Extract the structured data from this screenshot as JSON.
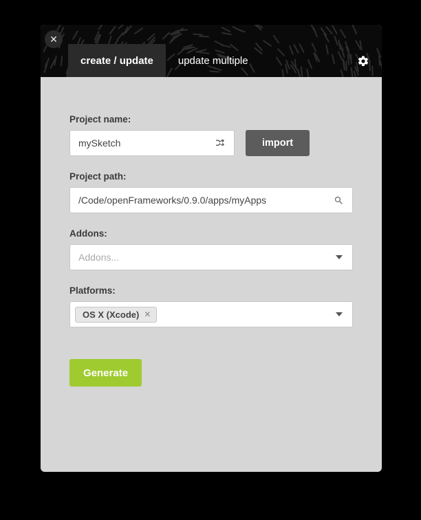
{
  "tabs": {
    "create_update": "create / update",
    "update_multiple": "update multiple"
  },
  "fields": {
    "project_name": {
      "label": "Project name:",
      "value": "mySketch"
    },
    "import_label": "import",
    "project_path": {
      "label": "Project path:",
      "value": "/Code/openFrameworks/0.9.0/apps/myApps"
    },
    "addons": {
      "label": "Addons:",
      "placeholder": "Addons..."
    },
    "platforms": {
      "label": "Platforms:",
      "selected": [
        "OS X (Xcode)"
      ]
    }
  },
  "buttons": {
    "generate": "Generate"
  },
  "colors": {
    "accent": "#9fcb30",
    "import_btn": "#5c5c5c"
  }
}
